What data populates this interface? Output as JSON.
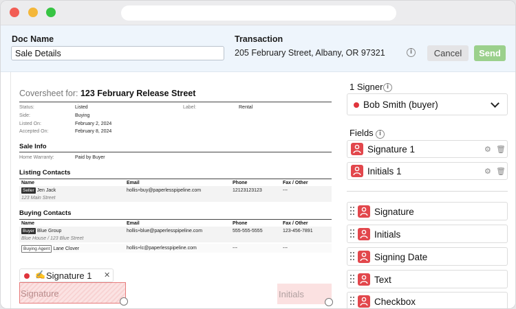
{
  "header": {
    "doc_name_label": "Doc Name",
    "doc_name_value": "Sale Details",
    "transaction_label": "Transaction",
    "transaction_address": "205 February Street, Albany, OR 97321",
    "cancel_label": "Cancel",
    "send_label": "Send"
  },
  "document": {
    "title_prefix": "Coversheet for:",
    "title_property": "123 February Release Street",
    "details": {
      "status_k": "Status:",
      "status_v": "Listed",
      "label_k": "Label:",
      "label_v": "Rental",
      "side_k": "Side:",
      "side_v": "Buying",
      "listed_k": "Listed On:",
      "listed_v": "February 2, 2024",
      "accepted_k": "Accepted On:",
      "accepted_v": "February 8, 2024"
    },
    "sale_info": {
      "heading": "Sale Info",
      "warranty_k": "Home Warranty:",
      "warranty_v": "Paid by Buyer"
    },
    "table_headers": {
      "name": "Name",
      "email": "Email",
      "phone": "Phone",
      "fax": "Fax / Other"
    },
    "listing_contacts": {
      "heading": "Listing Contacts",
      "rows": [
        {
          "role": "Seller",
          "name": "Jen Jack",
          "sub": "123 Main Street",
          "email": "hollis+buy@paperlesspipeline.com",
          "phone": "12123123123",
          "fax": "---"
        }
      ]
    },
    "buying_contacts": {
      "heading": "Buying Contacts",
      "rows": [
        {
          "role": "Buyer",
          "name": "Blue Group",
          "sub": "Blue House / 123 Blue Street",
          "email": "hollis+blue@paperlesspipeline.com",
          "phone": "555-555-5555",
          "fax": "123-456-7891"
        },
        {
          "role": "Buying Agent",
          "name": "Lane Clover",
          "sub": "",
          "email": "hollis+lc@paperlesspipeline.com",
          "phone": "---",
          "fax": "---"
        }
      ]
    },
    "signature_tag": "Signature 1",
    "signature_placeholder": "Signature",
    "initials_placeholder": "Initials"
  },
  "sidebar": {
    "signer_heading": "1 Signer",
    "signer_selected": "Bob Smith (buyer)",
    "signer_color": "#e0343c",
    "fields_heading": "Fields",
    "placed_fields": [
      "Signature 1",
      "Initials 1"
    ],
    "field_types": [
      "Signature",
      "Initials",
      "Signing Date",
      "Text",
      "Checkbox"
    ],
    "field_icon": "person-icon",
    "field_icon_color": "#e2474c"
  }
}
